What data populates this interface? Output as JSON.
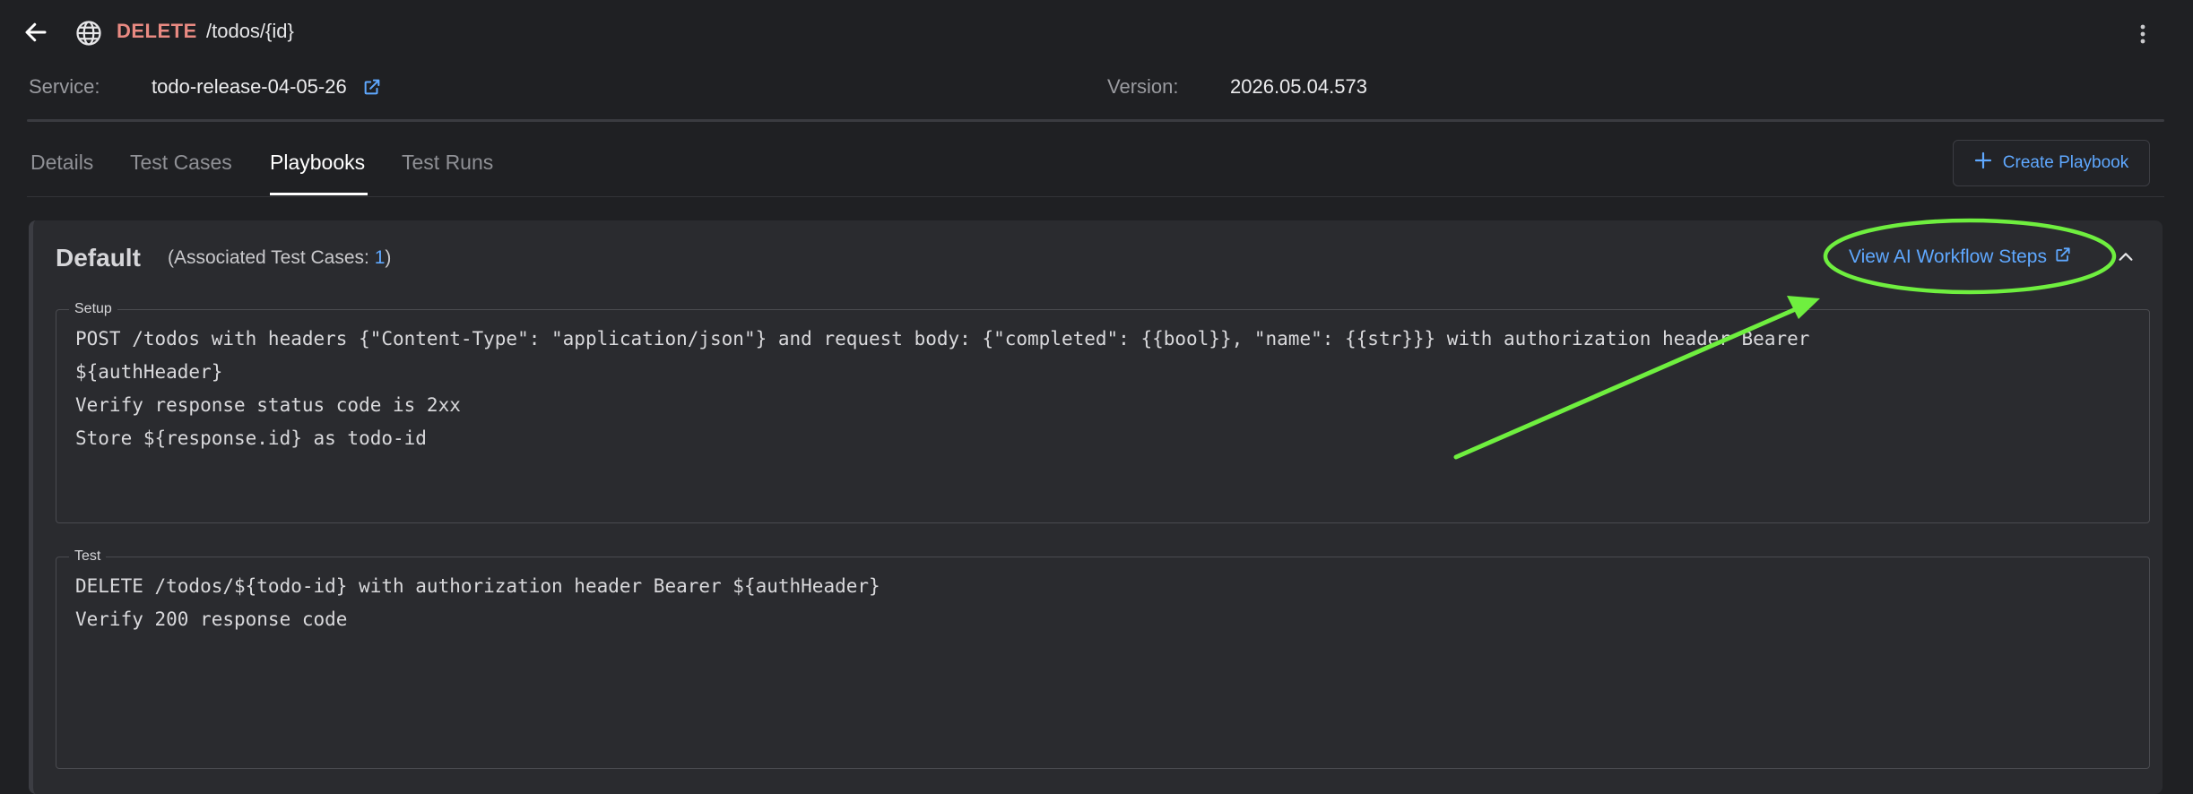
{
  "header": {
    "back_icon": "arrow-left-icon",
    "globe_icon": "globe-icon",
    "method": "DELETE",
    "path": "/todos/{id}",
    "menu_icon": "more-vertical-icon"
  },
  "service": {
    "label": "Service:",
    "value": "todo-release-04-05-26",
    "link_icon": "external-link-icon",
    "version_label": "Version:",
    "version_value": "2026.05.04.573"
  },
  "tabs": [
    {
      "label": "Details",
      "active": false
    },
    {
      "label": "Test Cases",
      "active": false
    },
    {
      "label": "Playbooks",
      "active": true
    },
    {
      "label": "Test Runs",
      "active": false
    }
  ],
  "create_button": {
    "label": "Create Playbook",
    "icon": "plus-icon"
  },
  "playbook": {
    "name": "Default",
    "assoc_prefix": "(Associated Test Cases: ",
    "assoc_count": "1",
    "assoc_suffix": ")",
    "view_ai_label": "View AI Workflow Steps",
    "view_ai_icon": "external-link-icon",
    "collapse_icon": "chevron-up-icon",
    "setup_label": "Setup",
    "setup_lines": [
      "POST /todos with headers {\"Content-Type\": \"application/json\"} and request body: {\"completed\": {{bool}}, \"name\": {{str}}} with authorization header Bearer",
      "${authHeader}",
      "Verify response status code is 2xx",
      "Store ${response.id} as todo-id"
    ],
    "test_label": "Test",
    "test_lines": [
      "DELETE /todos/${todo-id} with authorization header Bearer ${authHeader}",
      "Verify 200 response code"
    ]
  },
  "colors": {
    "background": "#1f2023",
    "card": "#2a2b2f",
    "accent_link": "#5fa8ff",
    "method_delete": "#e98a82",
    "annotation_green": "#6fef3f"
  }
}
